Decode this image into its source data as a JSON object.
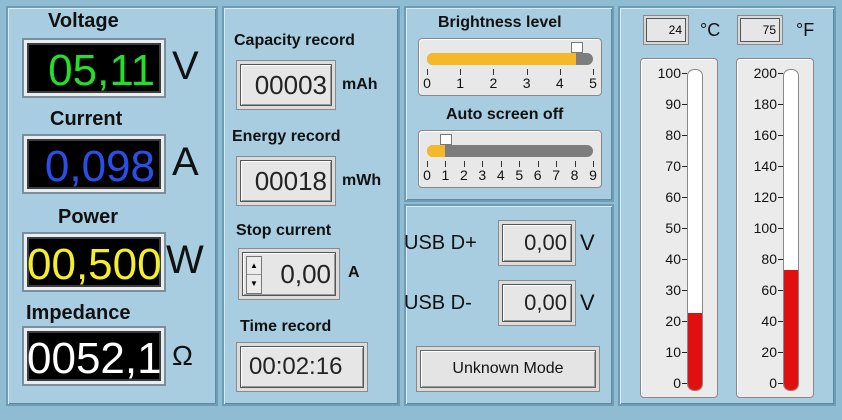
{
  "left": {
    "voltage": {
      "label": "Voltage",
      "value": "05,11",
      "unit": "V",
      "color": "#22e02a"
    },
    "current": {
      "label": "Current",
      "value": "0,098",
      "unit": "A",
      "color": "#2a4fe8"
    },
    "power": {
      "label": "Power",
      "value": "00,500",
      "unit": "W",
      "color": "#f3f02a"
    },
    "impedance": {
      "label": "Impedance",
      "value": "0052,1",
      "unit": "Ω",
      "color": "#ffffff"
    }
  },
  "records": {
    "capacity": {
      "label": "Capacity record",
      "value": "00003",
      "unit": "mAh"
    },
    "energy": {
      "label": "Energy record",
      "value": "00018",
      "unit": "mWh"
    },
    "stop_current": {
      "label": "Stop current",
      "value": "0,00",
      "unit": "A"
    },
    "time": {
      "label": "Time record",
      "value": "00:02:16"
    }
  },
  "brightness": {
    "label": "Brightness level",
    "ticks": [
      "0",
      "1",
      "2",
      "3",
      "4",
      "5"
    ],
    "value": 4.5,
    "max": 5
  },
  "auto_screen_off": {
    "label": "Auto screen off",
    "ticks": [
      "0",
      "1",
      "2",
      "3",
      "4",
      "5",
      "6",
      "7",
      "8",
      "9"
    ],
    "value": 1,
    "max": 9
  },
  "usb": {
    "dplus": {
      "label": "USB D+",
      "value": "0,00",
      "unit": "V"
    },
    "dminus": {
      "label": "USB D-",
      "value": "0,00",
      "unit": "V"
    },
    "mode_button": "Unknown Mode"
  },
  "temperature": {
    "celsius": {
      "value": "24",
      "unit": "°C",
      "ticks": [
        "100",
        "90",
        "80",
        "70",
        "60",
        "50",
        "40",
        "30",
        "20",
        "10",
        "0"
      ],
      "level": 24,
      "max": 100
    },
    "fahrenheit": {
      "value": "75",
      "unit": "°F",
      "ticks": [
        "200",
        "180",
        "160",
        "140",
        "120",
        "100",
        "80",
        "60",
        "40",
        "20",
        "0"
      ],
      "level": 75,
      "max": 200
    }
  }
}
